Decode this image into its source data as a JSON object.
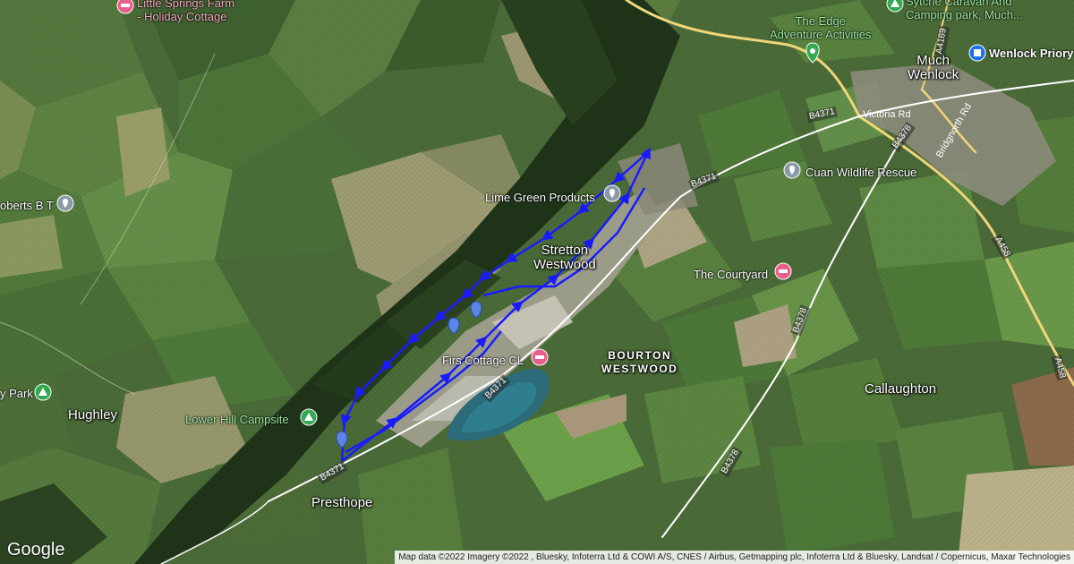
{
  "places": {
    "much_wenlock": "Much\nWenlock",
    "stretton_westwood": "Stretton\nWestwood",
    "bourton_westwood": "BOURTON\nWESTWOOD",
    "callaughton": "Callaughton",
    "hughley": "Hughley",
    "presthope": "Presthope"
  },
  "pois": {
    "little_springs": "Little Springs Farm\n- Holiday Cottage",
    "edge_adventure": "The Edge\nAdventure Activities",
    "sytche": "Sytche Caravan And\nCamping park, Much...",
    "wenlock_priory": "Wenlock Priory",
    "cuan_wildlife": "Cuan Wildlife Rescue",
    "lime_green": "Lime Green Products",
    "courtyard": "The Courtyard",
    "firs_cottage": "Firs Cottage CL",
    "lower_hill": "Lower Hill Campsite",
    "roberts": "oberts B T",
    "park": "y Park"
  },
  "roads": {
    "b4371_a": "B4371",
    "b4371_b": "B4371",
    "b4371_c": "B4371",
    "b4371_d": "B4371",
    "b4378_a": "B4378",
    "b4378_b": "B4378",
    "b4378_c": "B4378",
    "a458_a": "A458",
    "a458_b": "A458",
    "a4169": "A4169",
    "victoria_rd": "Victoria Rd",
    "bridgnorth_rd": "Bridgnorth Rd"
  },
  "branding": {
    "logo": "Google",
    "attribution": "Map data ©2022 Imagery ©2022 , Bluesky, Infoterra Ltd & COWI A/S, CNES / Airbus, Getmapping plc, Infoterra Ltd & Bluesky, Landsat / Copernicus, Maxar Technologies"
  },
  "colors": {
    "route": "#1a1aff",
    "marker": "#5b86e5",
    "poi_green": "#34a853",
    "poi_pink": "#e85f8b",
    "poi_gray": "#8a9aa6",
    "poi_blue": "#1a73e8"
  },
  "icons": [
    "location-marker-icon",
    "hotel-icon",
    "campsite-icon",
    "pin-icon",
    "landmark-icon"
  ]
}
